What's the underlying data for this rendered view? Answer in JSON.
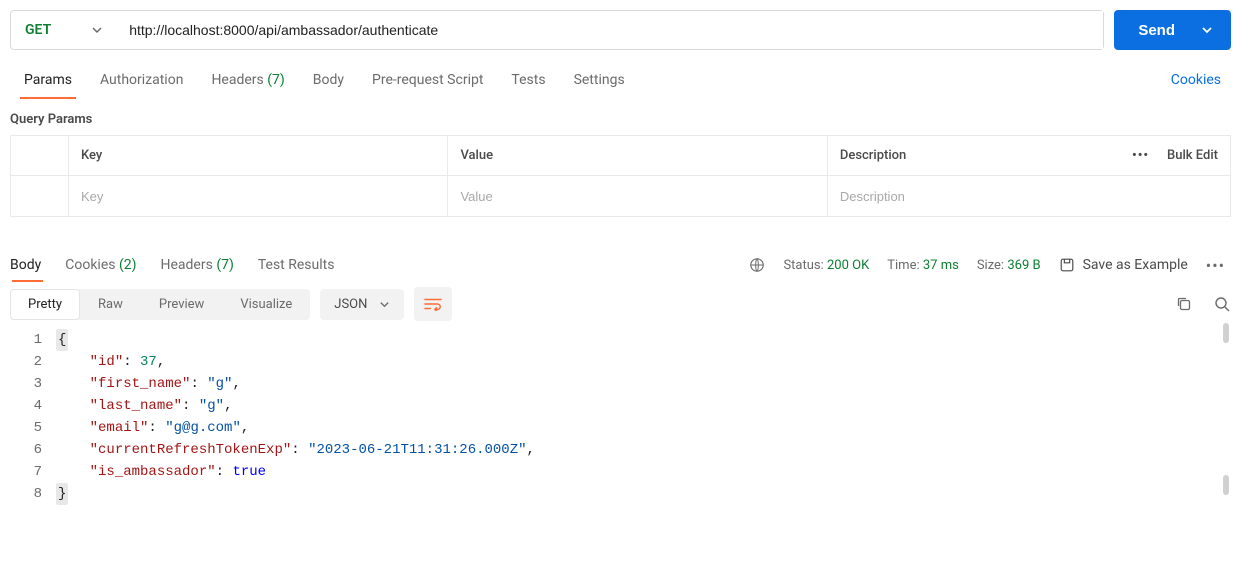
{
  "request": {
    "method": "GET",
    "url": "http://localhost:8000/api/ambassador/authenticate",
    "send_label": "Send"
  },
  "req_tabs": {
    "params": "Params",
    "authorization": "Authorization",
    "headers_label": "Headers",
    "headers_count": "(7)",
    "body": "Body",
    "prerequest": "Pre-request Script",
    "tests": "Tests",
    "settings": "Settings",
    "cookies": "Cookies"
  },
  "query_params": {
    "title": "Query Params",
    "columns": {
      "key": "Key",
      "value": "Value",
      "description": "Description"
    },
    "placeholders": {
      "key": "Key",
      "value": "Value",
      "description": "Description"
    },
    "bulk_edit": "Bulk Edit"
  },
  "resp_tabs": {
    "body": "Body",
    "cookies_label": "Cookies",
    "cookies_count": "(2)",
    "headers_label": "Headers",
    "headers_count": "(7)",
    "test_results": "Test Results"
  },
  "resp_status": {
    "status_label": "Status:",
    "status_value": "200 OK",
    "time_label": "Time:",
    "time_value": "37 ms",
    "size_label": "Size:",
    "size_value": "369 B",
    "save_as_example": "Save as Example"
  },
  "body_toolbar": {
    "pretty": "Pretty",
    "raw": "Raw",
    "preview": "Preview",
    "visualize": "Visualize",
    "format": "JSON"
  },
  "json_body": {
    "lines": [
      "1",
      "2",
      "3",
      "4",
      "5",
      "6",
      "7",
      "8"
    ],
    "data": {
      "id": 37,
      "first_name": "g",
      "last_name": "g",
      "email": "g@g.com",
      "currentRefreshTokenExp": "2023-06-21T11:31:26.000Z",
      "is_ambassador": true
    }
  }
}
